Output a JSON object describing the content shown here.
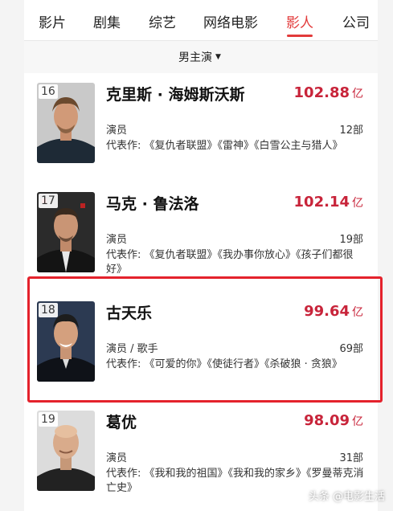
{
  "tabs": [
    "影片",
    "剧集",
    "综艺",
    "网络电影",
    "影人",
    "公司"
  ],
  "active_tab": "影人",
  "filter": {
    "label": "男主演"
  },
  "accent_color": "#e23b3b",
  "amount_color": "#c8243a",
  "highlight_color": "#e4222c",
  "actors": [
    {
      "rank": "16",
      "name": "克里斯 · 海姆斯沃斯",
      "box_office": "102.88",
      "unit": "亿",
      "role": "演员",
      "count": "12部",
      "works": "代表作: 《复仇者联盟》《雷神》《白雪公主与猎人》"
    },
    {
      "rank": "17",
      "name": "马克 · 鲁法洛",
      "box_office": "102.14",
      "unit": "亿",
      "role": "演员",
      "count": "19部",
      "works": "代表作: 《复仇者联盟》《我办事你放心》《孩子们都很好》"
    },
    {
      "rank": "18",
      "name": "古天乐",
      "box_office": "99.64",
      "unit": "亿",
      "role": "演员 / 歌手",
      "count": "69部",
      "works": "代表作: 《可爱的你》《使徒行者》《杀破狼 · 贪狼》"
    },
    {
      "rank": "19",
      "name": "葛优",
      "box_office": "98.09",
      "unit": "亿",
      "role": "演员",
      "count": "31部",
      "works": "代表作: 《我和我的祖国》《我和我的家乡》《罗曼蒂克消亡史》"
    }
  ],
  "watermark": "头条 @电影生活"
}
